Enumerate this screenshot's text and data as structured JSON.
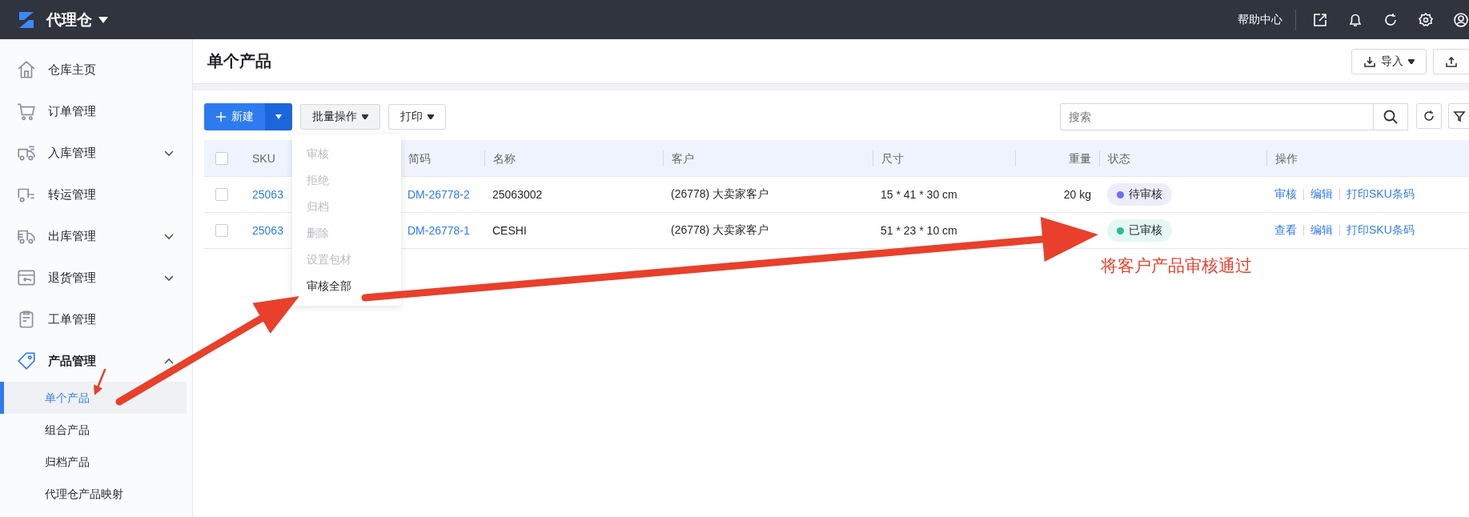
{
  "app": {
    "title": "代理仓"
  },
  "top_bar": {
    "help": "帮助中心"
  },
  "sidebar": {
    "items": [
      {
        "label": "仓库主页"
      },
      {
        "label": "订单管理"
      },
      {
        "label": "入库管理",
        "expanded": false
      },
      {
        "label": "转运管理"
      },
      {
        "label": "出库管理",
        "expanded": false
      },
      {
        "label": "退货管理",
        "expanded": false
      },
      {
        "label": "工单管理"
      },
      {
        "label": "产品管理",
        "expanded": true,
        "children": [
          {
            "label": "单个产品",
            "selected": true
          },
          {
            "label": "组合产品",
            "selected": false
          },
          {
            "label": "归档产品",
            "selected": false
          },
          {
            "label": "代理仓产品映射",
            "selected": false
          }
        ]
      }
    ]
  },
  "page": {
    "title": "单个产品",
    "import_button": "导入"
  },
  "toolbar": {
    "new_button": "新建",
    "batch_button": "批量操作",
    "print_button": "打印",
    "search": {
      "placeholder": "搜索"
    }
  },
  "batch_menu": {
    "items": [
      {
        "label": "审核",
        "disabled": true
      },
      {
        "label": "拒绝",
        "disabled": true
      },
      {
        "label": "归档",
        "disabled": true
      },
      {
        "label": "删除",
        "disabled": true
      },
      {
        "label": "设置包材",
        "disabled": true
      },
      {
        "label": "审核全部",
        "disabled": false
      }
    ]
  },
  "table": {
    "header_checked": false,
    "columns": [
      "SKU",
      "简码",
      "名称",
      "客户",
      "尺寸",
      "重量",
      "状态",
      "操作"
    ],
    "rows": [
      {
        "checked": false,
        "sku": "25063",
        "code": "DM-26778-2",
        "name": "25063002",
        "customer": "(26778) 大卖家客户",
        "size": "15 * 41 * 30 cm",
        "weight": "20 kg",
        "status": {
          "label": "待审核",
          "color": "#6a6ff5"
        },
        "actions": [
          "审核",
          "编辑",
          "打印SKU条码"
        ]
      },
      {
        "checked": false,
        "sku": "25063",
        "code": "DM-26778-1",
        "name": "CESHI",
        "customer": "(26778) 大卖家客户",
        "size": "51 * 23 * 10 cm",
        "status": {
          "label": "已审核",
          "color": "#26bf94"
        },
        "actions": [
          "查看",
          "编辑",
          "打印SKU条码"
        ]
      }
    ]
  },
  "annotation": {
    "text": "将客户产品审核通过"
  }
}
